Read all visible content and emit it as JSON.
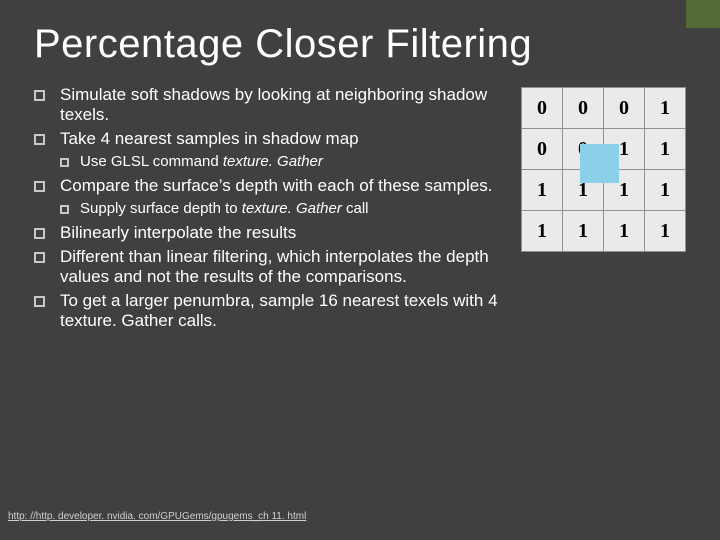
{
  "title": "Percentage Closer Filtering",
  "bullets": [
    {
      "level": 1,
      "text": "Simulate soft shadows by looking at neighboring shadow texels."
    },
    {
      "level": 1,
      "text": "Take 4 nearest samples in shadow map"
    },
    {
      "level": 2,
      "html": "Use GLSL command <em class=\"it\">texture. Gather</em>"
    },
    {
      "level": 1,
      "text": "Compare the surface’s depth with each  of these samples."
    },
    {
      "level": 2,
      "html": "Supply surface depth to <em class=\"it\">texture. Gather</em> call"
    },
    {
      "level": 1,
      "text": "Bilinearly interpolate the results"
    },
    {
      "level": 1,
      "text": "Different than linear filtering, which interpolates the depth values and not the results of the comparisons."
    },
    {
      "level": 1,
      "text": "To get a larger penumbra, sample 16 nearest texels with 4 texture. Gather calls."
    }
  ],
  "grid": [
    [
      "0",
      "0",
      "0",
      "1"
    ],
    [
      "0",
      "0",
      "1",
      "1"
    ],
    [
      "1",
      "1",
      "1",
      "1"
    ],
    [
      "1",
      "1",
      "1",
      "1"
    ]
  ],
  "highlight": {
    "row0": 1,
    "col0": 1,
    "row1": 2,
    "col1": 2
  },
  "footer": "http: //http. developer. nvidia. com/GPUGems/gpugems_ch 11. html"
}
